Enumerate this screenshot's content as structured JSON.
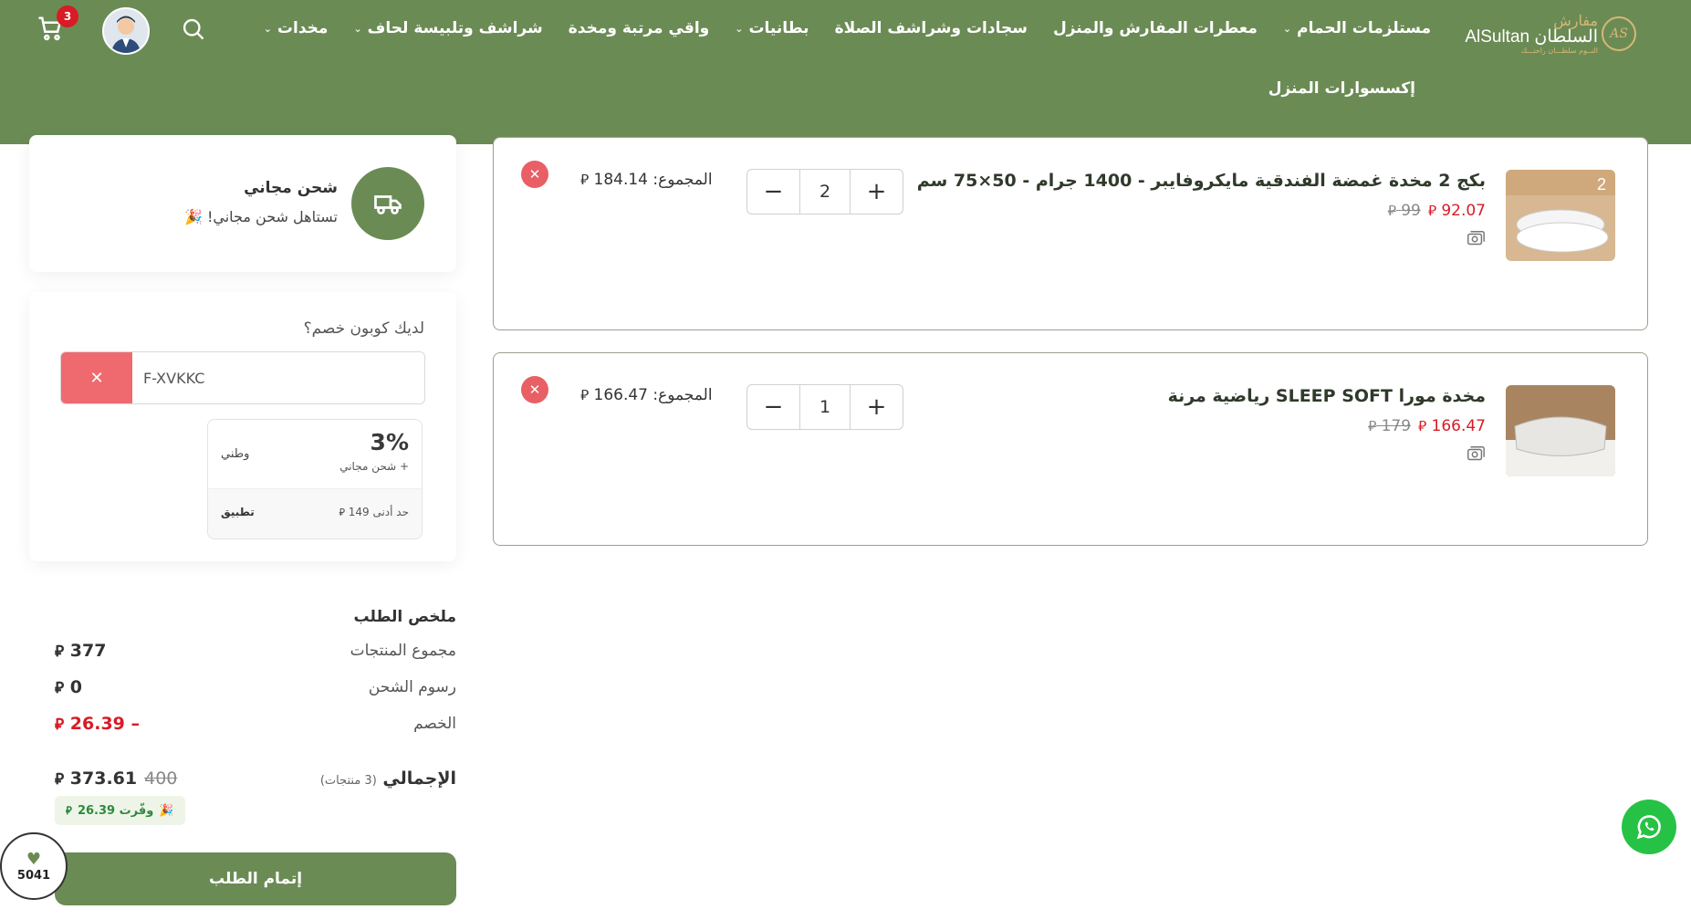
{
  "header": {
    "logo": {
      "seal": "AS",
      "top_text": "مفارش",
      "main_text": "AlSultan السلطان",
      "sub_text": "النــوم سلطـــان راحتـــك"
    },
    "nav": [
      {
        "label": "مخدات",
        "has_dropdown": true
      },
      {
        "label": "شراشف وتلبيسة لحاف",
        "has_dropdown": true
      },
      {
        "label": "واقي مرتبة ومخدة",
        "has_dropdown": false
      },
      {
        "label": "بطانيات",
        "has_dropdown": true
      },
      {
        "label": "سجادات وشراشف الصلاة",
        "has_dropdown": false
      },
      {
        "label": "معطرات المفارش والمنزل",
        "has_dropdown": false
      },
      {
        "label": "مستلزمات الحمام",
        "has_dropdown": true
      }
    ],
    "nav_row2": "إكسسوارات المنزل",
    "cart_count": "3",
    "icons": {
      "search": "search-icon",
      "cart": "cart-icon",
      "avatar": "avatar-icon"
    }
  },
  "cart_items": [
    {
      "title": "بكج 2 مخدة غمضة الفندقية مايكروفايبر - 1400 جرام - 50×75 سم",
      "price_old": "99",
      "price_new": "92.07",
      "quantity": "2",
      "total_label": "المجموع: 184.14",
      "image_badge": "2"
    },
    {
      "title": "مخدة مورا SLEEP SOFT رياضية مرنة",
      "price_old": "179",
      "price_new": "166.47",
      "quantity": "1",
      "total_label": "المجموع: 166.47"
    }
  ],
  "currency_symbol": "⃁",
  "shipping": {
    "title": "شحن مجاني",
    "subtitle": "تستاهل شحن مجاني! 🎉"
  },
  "coupon": {
    "label": "لديك كوبون خصم؟",
    "value": "F-XVKKC",
    "offer": {
      "percent": "3%",
      "extra": "+ شحن مجاني",
      "name": "وطني",
      "min": "حد أدنى 149",
      "apply": "تطبيق"
    }
  },
  "summary": {
    "title": "ملخص الطلب",
    "rows": [
      {
        "label": "مجموع المنتجات",
        "value": "377"
      },
      {
        "label": "رسوم الشحن",
        "value": "0"
      },
      {
        "label": "الخصم",
        "value": "– 26.39"
      }
    ],
    "total_label": "الإجمالي",
    "total_count": "(3 منتجات)",
    "total_old": "400",
    "total_new": "373.61",
    "saved": "وفّرت 26.39",
    "checkout": "إتمام الطلب"
  },
  "wishlist_count": "5041",
  "colors": {
    "brand": "#6b8b55",
    "price_red": "#d81b25",
    "remove": "#e85f65",
    "whatsapp": "#26c245"
  }
}
